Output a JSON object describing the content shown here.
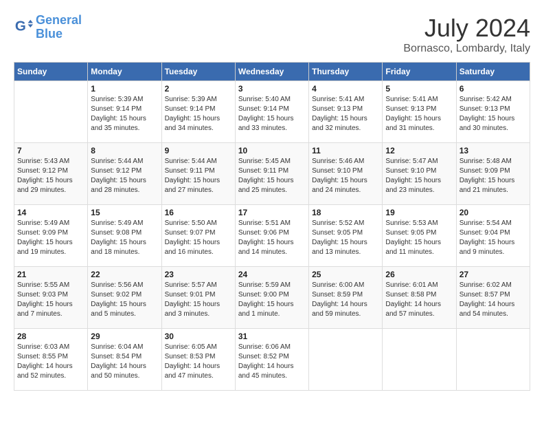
{
  "header": {
    "logo_line1": "General",
    "logo_line2": "Blue",
    "month_year": "July 2024",
    "location": "Bornasco, Lombardy, Italy"
  },
  "weekdays": [
    "Sunday",
    "Monday",
    "Tuesday",
    "Wednesday",
    "Thursday",
    "Friday",
    "Saturday"
  ],
  "weeks": [
    [
      {
        "day": "",
        "content": ""
      },
      {
        "day": "1",
        "content": "Sunrise: 5:39 AM\nSunset: 9:14 PM\nDaylight: 15 hours\nand 35 minutes."
      },
      {
        "day": "2",
        "content": "Sunrise: 5:39 AM\nSunset: 9:14 PM\nDaylight: 15 hours\nand 34 minutes."
      },
      {
        "day": "3",
        "content": "Sunrise: 5:40 AM\nSunset: 9:14 PM\nDaylight: 15 hours\nand 33 minutes."
      },
      {
        "day": "4",
        "content": "Sunrise: 5:41 AM\nSunset: 9:13 PM\nDaylight: 15 hours\nand 32 minutes."
      },
      {
        "day": "5",
        "content": "Sunrise: 5:41 AM\nSunset: 9:13 PM\nDaylight: 15 hours\nand 31 minutes."
      },
      {
        "day": "6",
        "content": "Sunrise: 5:42 AM\nSunset: 9:13 PM\nDaylight: 15 hours\nand 30 minutes."
      }
    ],
    [
      {
        "day": "7",
        "content": "Sunrise: 5:43 AM\nSunset: 9:12 PM\nDaylight: 15 hours\nand 29 minutes."
      },
      {
        "day": "8",
        "content": "Sunrise: 5:44 AM\nSunset: 9:12 PM\nDaylight: 15 hours\nand 28 minutes."
      },
      {
        "day": "9",
        "content": "Sunrise: 5:44 AM\nSunset: 9:11 PM\nDaylight: 15 hours\nand 27 minutes."
      },
      {
        "day": "10",
        "content": "Sunrise: 5:45 AM\nSunset: 9:11 PM\nDaylight: 15 hours\nand 25 minutes."
      },
      {
        "day": "11",
        "content": "Sunrise: 5:46 AM\nSunset: 9:10 PM\nDaylight: 15 hours\nand 24 minutes."
      },
      {
        "day": "12",
        "content": "Sunrise: 5:47 AM\nSunset: 9:10 PM\nDaylight: 15 hours\nand 23 minutes."
      },
      {
        "day": "13",
        "content": "Sunrise: 5:48 AM\nSunset: 9:09 PM\nDaylight: 15 hours\nand 21 minutes."
      }
    ],
    [
      {
        "day": "14",
        "content": "Sunrise: 5:49 AM\nSunset: 9:09 PM\nDaylight: 15 hours\nand 19 minutes."
      },
      {
        "day": "15",
        "content": "Sunrise: 5:49 AM\nSunset: 9:08 PM\nDaylight: 15 hours\nand 18 minutes."
      },
      {
        "day": "16",
        "content": "Sunrise: 5:50 AM\nSunset: 9:07 PM\nDaylight: 15 hours\nand 16 minutes."
      },
      {
        "day": "17",
        "content": "Sunrise: 5:51 AM\nSunset: 9:06 PM\nDaylight: 15 hours\nand 14 minutes."
      },
      {
        "day": "18",
        "content": "Sunrise: 5:52 AM\nSunset: 9:05 PM\nDaylight: 15 hours\nand 13 minutes."
      },
      {
        "day": "19",
        "content": "Sunrise: 5:53 AM\nSunset: 9:05 PM\nDaylight: 15 hours\nand 11 minutes."
      },
      {
        "day": "20",
        "content": "Sunrise: 5:54 AM\nSunset: 9:04 PM\nDaylight: 15 hours\nand 9 minutes."
      }
    ],
    [
      {
        "day": "21",
        "content": "Sunrise: 5:55 AM\nSunset: 9:03 PM\nDaylight: 15 hours\nand 7 minutes."
      },
      {
        "day": "22",
        "content": "Sunrise: 5:56 AM\nSunset: 9:02 PM\nDaylight: 15 hours\nand 5 minutes."
      },
      {
        "day": "23",
        "content": "Sunrise: 5:57 AM\nSunset: 9:01 PM\nDaylight: 15 hours\nand 3 minutes."
      },
      {
        "day": "24",
        "content": "Sunrise: 5:59 AM\nSunset: 9:00 PM\nDaylight: 15 hours\nand 1 minute."
      },
      {
        "day": "25",
        "content": "Sunrise: 6:00 AM\nSunset: 8:59 PM\nDaylight: 14 hours\nand 59 minutes."
      },
      {
        "day": "26",
        "content": "Sunrise: 6:01 AM\nSunset: 8:58 PM\nDaylight: 14 hours\nand 57 minutes."
      },
      {
        "day": "27",
        "content": "Sunrise: 6:02 AM\nSunset: 8:57 PM\nDaylight: 14 hours\nand 54 minutes."
      }
    ],
    [
      {
        "day": "28",
        "content": "Sunrise: 6:03 AM\nSunset: 8:55 PM\nDaylight: 14 hours\nand 52 minutes."
      },
      {
        "day": "29",
        "content": "Sunrise: 6:04 AM\nSunset: 8:54 PM\nDaylight: 14 hours\nand 50 minutes."
      },
      {
        "day": "30",
        "content": "Sunrise: 6:05 AM\nSunset: 8:53 PM\nDaylight: 14 hours\nand 47 minutes."
      },
      {
        "day": "31",
        "content": "Sunrise: 6:06 AM\nSunset: 8:52 PM\nDaylight: 14 hours\nand 45 minutes."
      },
      {
        "day": "",
        "content": ""
      },
      {
        "day": "",
        "content": ""
      },
      {
        "day": "",
        "content": ""
      }
    ]
  ]
}
